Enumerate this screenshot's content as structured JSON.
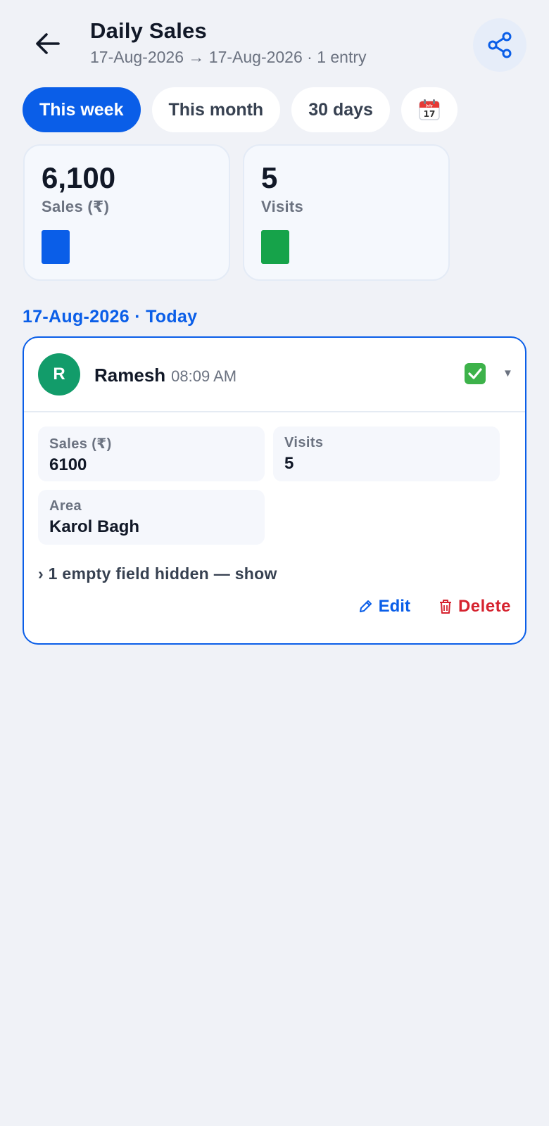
{
  "header": {
    "title": "Daily Sales",
    "subtitle": "17-Aug-2026 → 17-Aug-2026 · 1 entry"
  },
  "range_chips": [
    {
      "label": "This week",
      "active": true
    },
    {
      "label": "This month",
      "active": false
    },
    {
      "label": "30 days",
      "active": false
    }
  ],
  "calendar_chip": {
    "icon": "calendar-icon",
    "day": "17",
    "month": "July"
  },
  "stats": [
    {
      "value": "6,100",
      "label": "Sales (₹)",
      "color": "#0a5ee8",
      "fill": 1.0
    },
    {
      "value": "5",
      "label": "Visits",
      "color": "#16a34a",
      "fill": 1.0
    }
  ],
  "day_heading": "17-Aug-2026 · Today",
  "entry": {
    "avatar_initial": "R",
    "avatar_color": "#129c6a",
    "name": "Ramesh",
    "time": "08:09 AM",
    "status_icon": "check-mark-icon",
    "fields": [
      {
        "label": "Sales (₹)",
        "value": "6100"
      },
      {
        "label": "Visits",
        "value": "5"
      },
      {
        "label": "Area",
        "value": "Karol Bagh"
      }
    ],
    "hidden_toggle": "› 1 empty field hidden — show",
    "edit_label": "Edit",
    "delete_label": "Delete"
  },
  "colors": {
    "accent": "#0a5ee8",
    "danger": "#d6232f",
    "background": "#f0f2f7"
  }
}
